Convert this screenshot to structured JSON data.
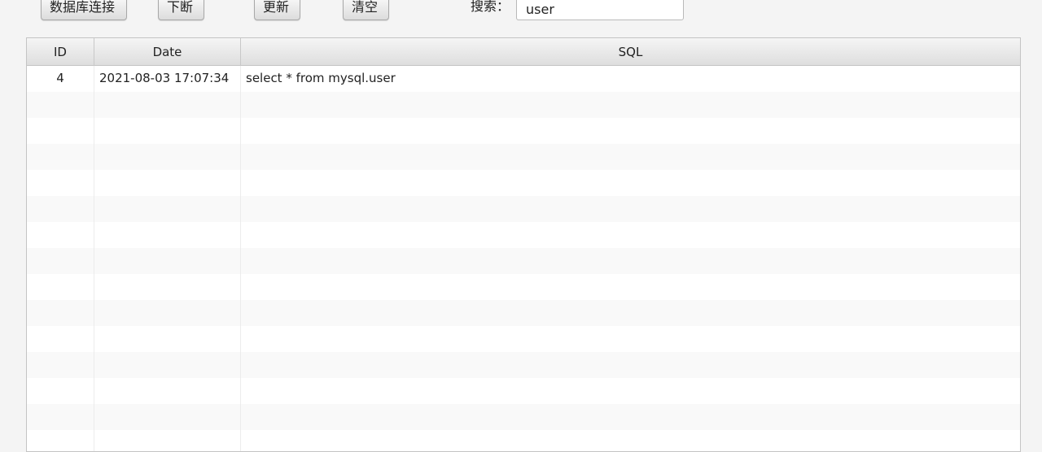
{
  "toolbar": {
    "connect_label": "数据库连接",
    "disconnect_label": "下断",
    "refresh_label": "更新",
    "clear_label": "清空",
    "search_label": "搜索：",
    "search_value": "user"
  },
  "table": {
    "columns": [
      "ID",
      "Date",
      "SQL"
    ],
    "rows": [
      {
        "id": "4",
        "date": "2021-08-03 17:07:34",
        "sql": "select * from mysql.user"
      }
    ],
    "empty_row_count": 14
  }
}
